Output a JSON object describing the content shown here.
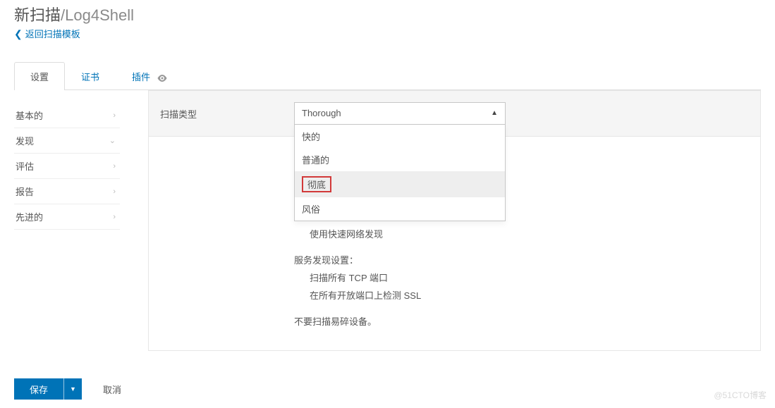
{
  "header": {
    "title_prefix": "新扫描",
    "title_separator": "/",
    "title_name": "Log4Shell",
    "back_link": "返回扫描模板"
  },
  "tabs": [
    {
      "label": "设置",
      "active": true
    },
    {
      "label": "证书",
      "active": false
    },
    {
      "label": "插件",
      "active": false,
      "has_eye": true
    }
  ],
  "side_nav": [
    {
      "label": "基本的",
      "expanded": false
    },
    {
      "label": "发现",
      "expanded": true
    },
    {
      "label": "评估",
      "expanded": false
    },
    {
      "label": "报告",
      "expanded": false
    },
    {
      "label": "先进的",
      "expanded": false
    }
  ],
  "scan_type": {
    "label": "扫描类型",
    "selected": "Thorough",
    "options": [
      {
        "label": "快的",
        "highlight": false
      },
      {
        "label": "普通的",
        "highlight": false
      },
      {
        "label": "彻底",
        "highlight": true
      },
      {
        "label": "风俗",
        "highlight": false
      }
    ]
  },
  "description": {
    "line1": "使用快速网络发现",
    "group_title": "服务发现设置：",
    "group_items": [
      "扫描所有 TCP 端口",
      "在所有开放端口上检测 SSL"
    ],
    "footer_line": "不要扫描易碎设备。"
  },
  "footer": {
    "save": "保存",
    "cancel": "取消"
  },
  "watermark": "@51CTO博客"
}
